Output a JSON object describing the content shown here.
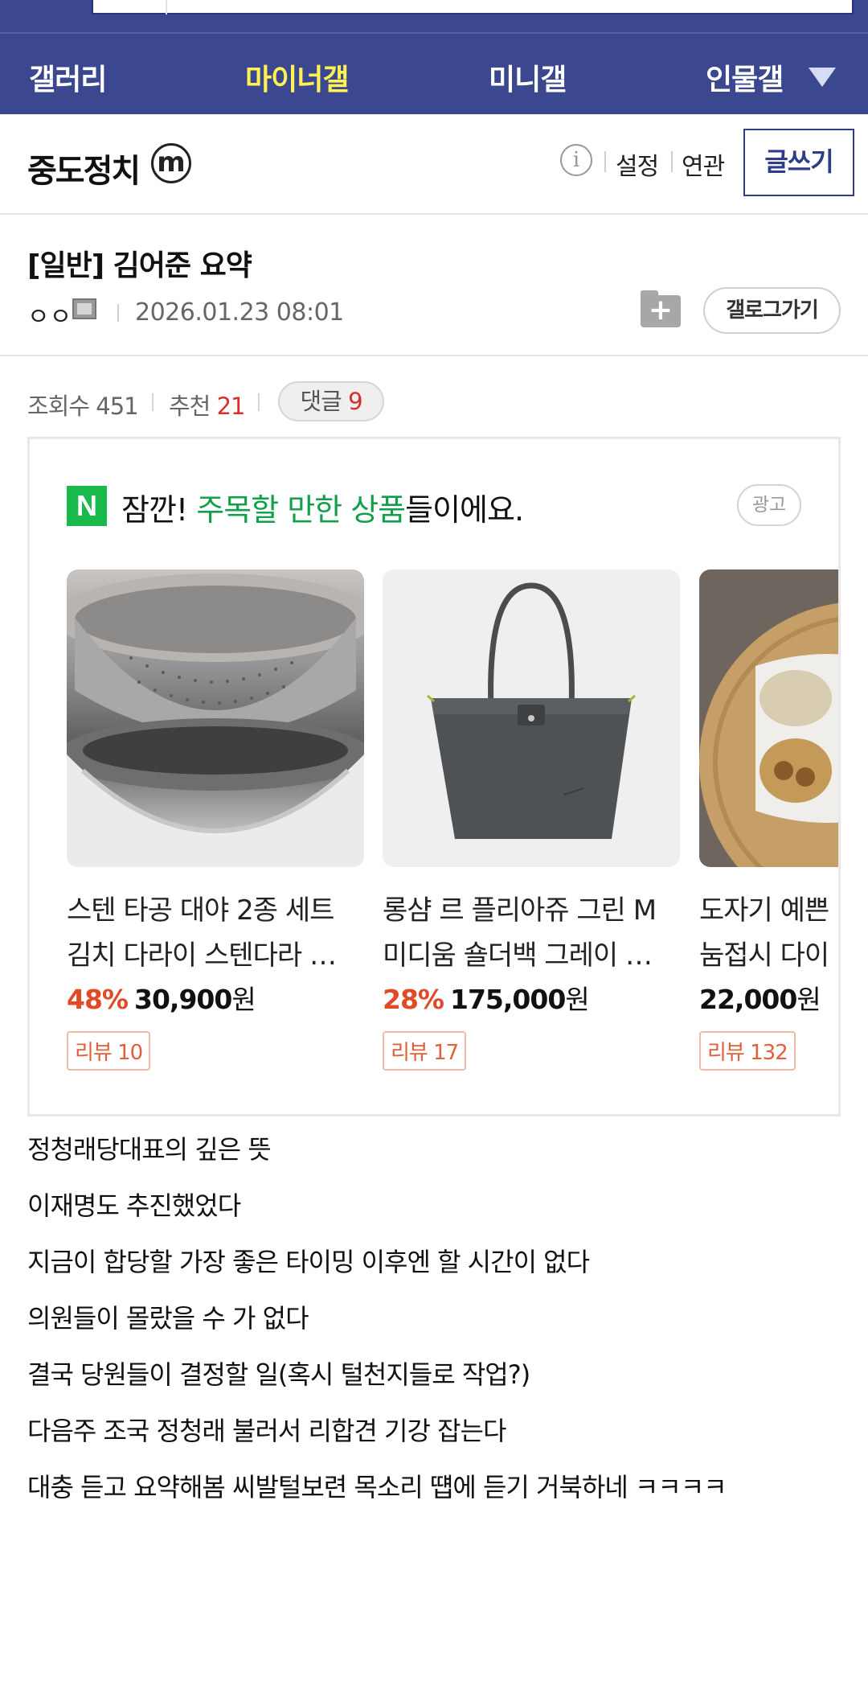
{
  "gallery_nav": {
    "items": [
      "갤러리",
      "마이너갤",
      "미니갤",
      "인물갤"
    ],
    "active": "마이너갤"
  },
  "gallery_header": {
    "name": "중도정치",
    "minor_badge": "m",
    "links": [
      "설정",
      "연관"
    ],
    "write_label": "글쓰기"
  },
  "post": {
    "title": "[일반] 김어준 요약",
    "author": "ㅇㅇ",
    "date": "2026.01.23 08:01",
    "gallog_label": "갤로그가기"
  },
  "stats": {
    "views_label": "조회수",
    "views": "451",
    "recommend_label": "추천",
    "recommend": "21",
    "comments_label": "댓글",
    "comments": "9"
  },
  "ad": {
    "logo": "N",
    "headline_pre": "잠깐! ",
    "headline_highlight": "주목할 만한 상품",
    "headline_post": "들이에요.",
    "badge": "광고",
    "products": [
      {
        "name_line1": "스텐 타공 대야 2종 세트",
        "name_line2": "김치 다라이 스텐다라 …",
        "discount": "48%",
        "price": "30,900",
        "unit": "원",
        "review": "리뷰 10"
      },
      {
        "name_line1": "롱샴 르 플리아쥬 그린 M",
        "name_line2": "미디움 숄더백 그레이 …",
        "discount": "28%",
        "price": "175,000",
        "unit": "원",
        "review": "리뷰 17"
      },
      {
        "name_line1": "도자기 예쁜",
        "name_line2": "눔접시 다이",
        "discount": "",
        "price": "22,000",
        "unit": "원",
        "review": "리뷰 132"
      }
    ]
  },
  "content": {
    "lines": [
      "정청래당대표의 깊은 뜻",
      "이재명도 추진했었다",
      "지금이 합당할 가장 좋은 타이밍 이후엔 할 시간이 없다",
      "의원들이 몰랐을 수 가 없다",
      "결국 당원들이 결정할 일(혹시 털천지들로 작업?)",
      "다음주 조국 정청래 불러서 리합견 기강 잡는다",
      "대충 듣고 요약해봄 씨발털보련 목소리 떕에 듣기 거북하네 ㅋㅋㅋㅋ"
    ]
  },
  "colors": {
    "nav_bg": "#3b4890",
    "nav_active": "#fff353",
    "accent_red": "#d7302a",
    "ad_green": "#11a04a"
  }
}
